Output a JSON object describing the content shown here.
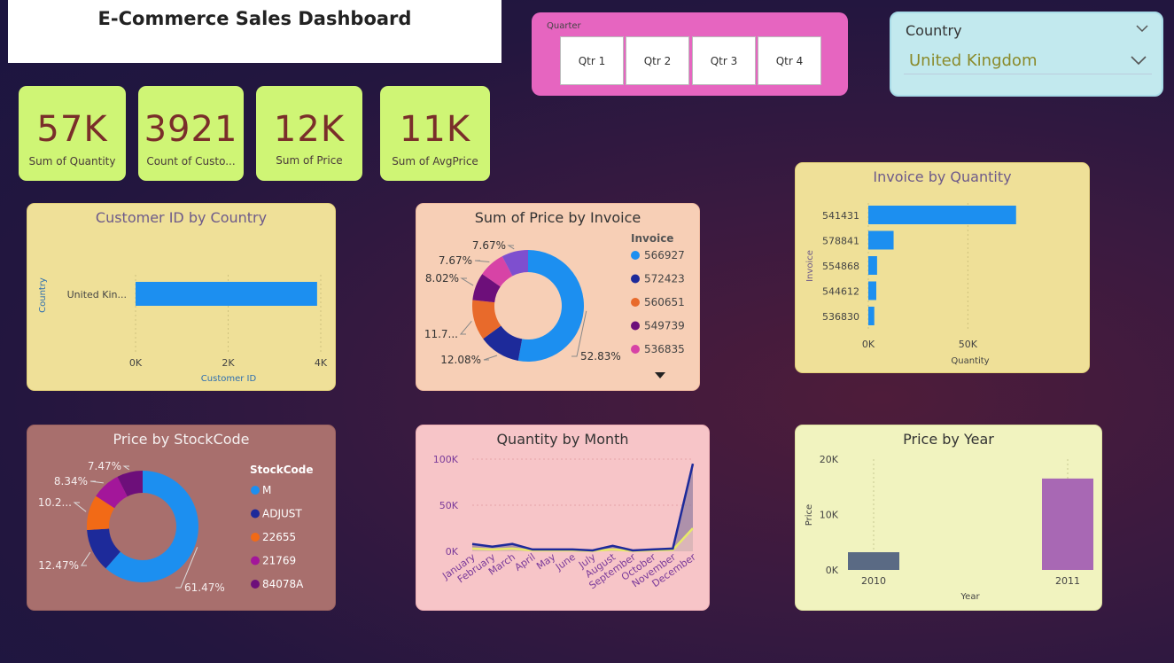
{
  "title": "E-Commerce Sales Dashboard",
  "kpis": [
    {
      "value": "57K",
      "label": "Sum of Quantity"
    },
    {
      "value": "3921",
      "label": "Count of Custo..."
    },
    {
      "value": "12K",
      "label": "Sum of Price"
    },
    {
      "value": "11K",
      "label": "Sum of AvgPrice"
    }
  ],
  "quarter_slicer": {
    "header": "Quarter",
    "options": [
      "Qtr 1",
      "Qtr 2",
      "Qtr 3",
      "Qtr 4"
    ]
  },
  "country_slicer": {
    "header": "Country",
    "selected": "United Kingdom"
  },
  "colors": {
    "blue": "#1c8ff0",
    "navy": "#1d2a9a",
    "orange": "#e86a2b",
    "purple": "#6d0f7a",
    "pink": "#d743a6",
    "violet": "#7e4fcf"
  },
  "chart_data": [
    {
      "id": "customer_country",
      "type": "bar",
      "title": "Customer ID by Country",
      "xlabel": "Customer ID",
      "ylabel": "Country",
      "categories": [
        "United Kin..."
      ],
      "values": [
        3921
      ],
      "xlim": [
        0,
        4000
      ],
      "ticks": [
        "0K",
        "2K",
        "4K"
      ]
    },
    {
      "id": "price_invoice",
      "type": "pie",
      "title": "Sum of Price by Invoice",
      "legend_title": "Invoice",
      "categories": [
        "566927",
        "572423",
        "560651",
        "549739",
        "536835"
      ],
      "values": [
        52.83,
        12.08,
        11.7,
        8.02,
        7.67,
        7.67
      ],
      "labels": [
        "52.83%",
        "12.08%",
        "11.7...",
        "8.02%",
        "7.67%",
        "7.67%"
      ]
    },
    {
      "id": "invoice_quantity",
      "type": "bar",
      "title": "Invoice by Quantity",
      "xlabel": "Quantity",
      "ylabel": "Invoice",
      "categories": [
        "541431",
        "578841",
        "554868",
        "544612",
        "536830"
      ],
      "values": [
        74200,
        12700,
        4400,
        4000,
        3000
      ],
      "xlim": [
        0,
        80000
      ],
      "ticks": [
        {
          "v": 0,
          "t": "0K"
        },
        {
          "v": 50000,
          "t": "50K"
        }
      ]
    },
    {
      "id": "price_stockcode",
      "type": "pie",
      "title": "Price by StockCode",
      "legend_title": "StockCode",
      "categories": [
        "M",
        "ADJUST",
        "22655",
        "21769",
        "84078A"
      ],
      "values": [
        61.47,
        12.47,
        10.2,
        8.34,
        7.47
      ],
      "labels": [
        "61.47%",
        "12.47%",
        "10.2...",
        "8.34%",
        "7.47%"
      ]
    },
    {
      "id": "quantity_month",
      "type": "line",
      "title": "Quantity by Month",
      "x": [
        "January",
        "February",
        "March",
        "April",
        "May",
        "June",
        "July",
        "August",
        "September",
        "October",
        "November",
        "December"
      ],
      "series": [
        {
          "values": [
            8000,
            5000,
            8000,
            2000,
            2000,
            2000,
            1000,
            6000,
            1000,
            2000,
            3000,
            95000
          ]
        },
        {
          "values": [
            3000,
            2000,
            3000,
            1000,
            1000,
            1000,
            500,
            2000,
            500,
            1000,
            1500,
            25000
          ]
        }
      ],
      "ylim": [
        0,
        100000
      ],
      "ticks": [
        {
          "v": 0,
          "t": "0K"
        },
        {
          "v": 50000,
          "t": "50K"
        },
        {
          "v": 100000,
          "t": "100K"
        }
      ]
    },
    {
      "id": "price_year",
      "type": "bar",
      "title": "Price by Year",
      "xlabel": "Year",
      "ylabel": "Price",
      "categories": [
        "2010",
        "2011"
      ],
      "values": [
        3200,
        16500
      ],
      "bar_colors": [
        "#5a6a84",
        "#a868b4"
      ],
      "ylim": [
        0,
        20000
      ],
      "ticks": [
        {
          "v": 0,
          "t": "0K"
        },
        {
          "v": 10000,
          "t": "10K"
        },
        {
          "v": 20000,
          "t": "20K"
        }
      ]
    }
  ]
}
